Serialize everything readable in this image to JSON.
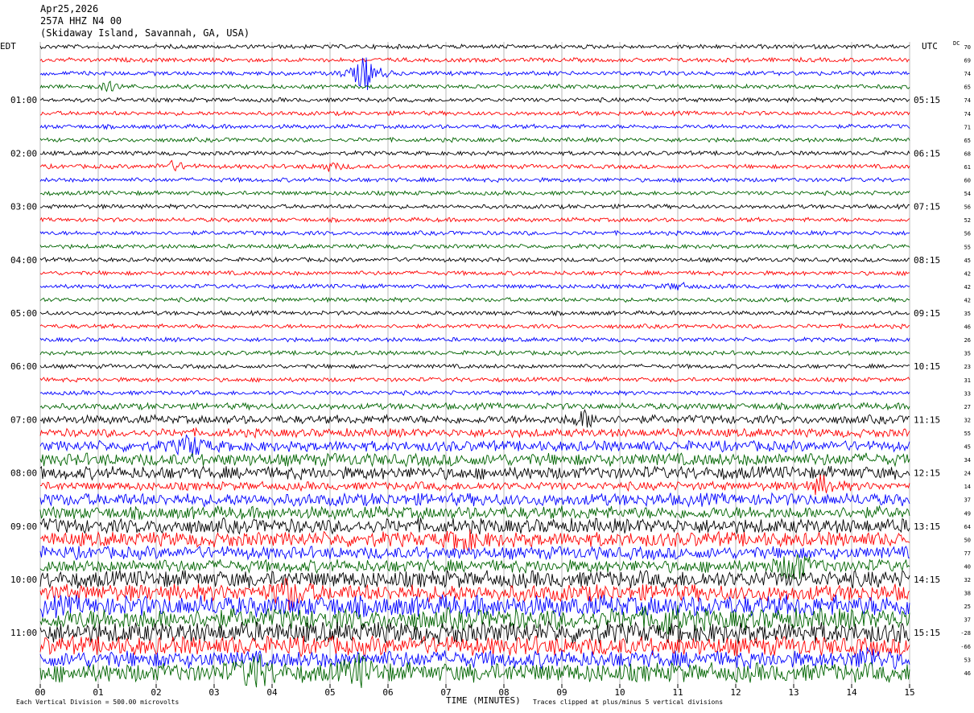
{
  "header": {
    "date": "Apr25,2026",
    "station": "257A HHZ N4 00",
    "location": "(Skidaway Island, Savannah, GA, USA)"
  },
  "labels": {
    "left_tz": "EDT",
    "right_tz": "UTC",
    "dc": "DC",
    "xlabel": "TIME (MINUTES)",
    "vertical_division": "Each Vertical Division =  500.00 microvolts",
    "clip_note": "Traces clipped at plus/minus 5 vertical divisions",
    "corner_mark": "\u0004"
  },
  "colors": {
    "cycle": [
      "#000000",
      "#ff0000",
      "#0000ff",
      "#006400"
    ],
    "grid": "#888888"
  },
  "chart_data": {
    "type": "line",
    "title": "",
    "xlabel": "TIME (MINUTES)",
    "xlim": [
      0,
      15
    ],
    "x_ticks": [
      "00",
      "01",
      "02",
      "03",
      "04",
      "05",
      "06",
      "07",
      "08",
      "09",
      "10",
      "11",
      "12",
      "13",
      "14",
      "15"
    ],
    "row_minutes": 15,
    "rows": 48,
    "left_hour_labels": [
      {
        "row": 4,
        "text": "01:00"
      },
      {
        "row": 8,
        "text": "02:00"
      },
      {
        "row": 12,
        "text": "03:00"
      },
      {
        "row": 16,
        "text": "04:00"
      },
      {
        "row": 20,
        "text": "05:00"
      },
      {
        "row": 24,
        "text": "06:00"
      },
      {
        "row": 28,
        "text": "07:00"
      },
      {
        "row": 32,
        "text": "08:00"
      },
      {
        "row": 36,
        "text": "09:00"
      },
      {
        "row": 40,
        "text": "10:00"
      },
      {
        "row": 44,
        "text": "11:00"
      }
    ],
    "right_hour_labels": [
      {
        "row": 4,
        "text": "05:15"
      },
      {
        "row": 8,
        "text": "06:15"
      },
      {
        "row": 12,
        "text": "07:15"
      },
      {
        "row": 16,
        "text": "08:15"
      },
      {
        "row": 20,
        "text": "09:15"
      },
      {
        "row": 24,
        "text": "10:15"
      },
      {
        "row": 28,
        "text": "11:15"
      },
      {
        "row": 32,
        "text": "12:15"
      },
      {
        "row": 36,
        "text": "13:15"
      },
      {
        "row": 40,
        "text": "14:15"
      },
      {
        "row": 44,
        "text": "15:15"
      }
    ],
    "dc_offsets": [
      70,
      69,
      74,
      65,
      74,
      74,
      71,
      65,
      68,
      61,
      60,
      54,
      56,
      52,
      56,
      55,
      45,
      42,
      42,
      42,
      35,
      46,
      26,
      35,
      23,
      31,
      33,
      27,
      32,
      55,
      45,
      34,
      24,
      14,
      37,
      49,
      64,
      50,
      77,
      40,
      32,
      38,
      25,
      37,
      -28,
      -66,
      53,
      46
    ],
    "trace_amplitude": [
      1,
      1,
      1,
      1,
      1,
      1,
      1,
      1,
      1,
      1,
      1,
      1,
      1,
      1,
      1,
      1,
      1,
      1,
      1,
      1,
      1,
      1,
      1,
      1,
      1,
      1,
      1,
      1.5,
      2,
      2,
      2.5,
      3,
      3,
      2,
      3,
      3,
      3.5,
      3.5,
      3,
      3,
      4,
      4,
      5,
      5,
      5,
      4.5,
      4,
      4.5
    ],
    "events": [
      {
        "row": 2,
        "minute": 5.6,
        "amplitude": 24
      },
      {
        "row": 3,
        "minute": 1.2,
        "amplitude": 5
      },
      {
        "row": 9,
        "minute": 2.3,
        "amplitude": 6
      },
      {
        "row": 9,
        "minute": 5.0,
        "amplitude": 5
      },
      {
        "row": 18,
        "minute": 11.0,
        "amplitude": 4
      },
      {
        "row": 28,
        "minute": 9.4,
        "amplitude": 10
      },
      {
        "row": 30,
        "minute": 2.6,
        "amplitude": 14
      },
      {
        "row": 33,
        "minute": 13.5,
        "amplitude": 12
      },
      {
        "row": 37,
        "minute": 7.3,
        "amplitude": 12
      },
      {
        "row": 39,
        "minute": 13.0,
        "amplitude": 22
      },
      {
        "row": 41,
        "minute": 4.3,
        "amplitude": 18
      },
      {
        "row": 43,
        "minute": 10.8,
        "amplitude": 14
      },
      {
        "row": 47,
        "minute": 3.7,
        "amplitude": 20
      },
      {
        "row": 47,
        "minute": 5.5,
        "amplitude": 16
      },
      {
        "row": 46,
        "minute": 14.3,
        "amplitude": 12
      }
    ]
  }
}
